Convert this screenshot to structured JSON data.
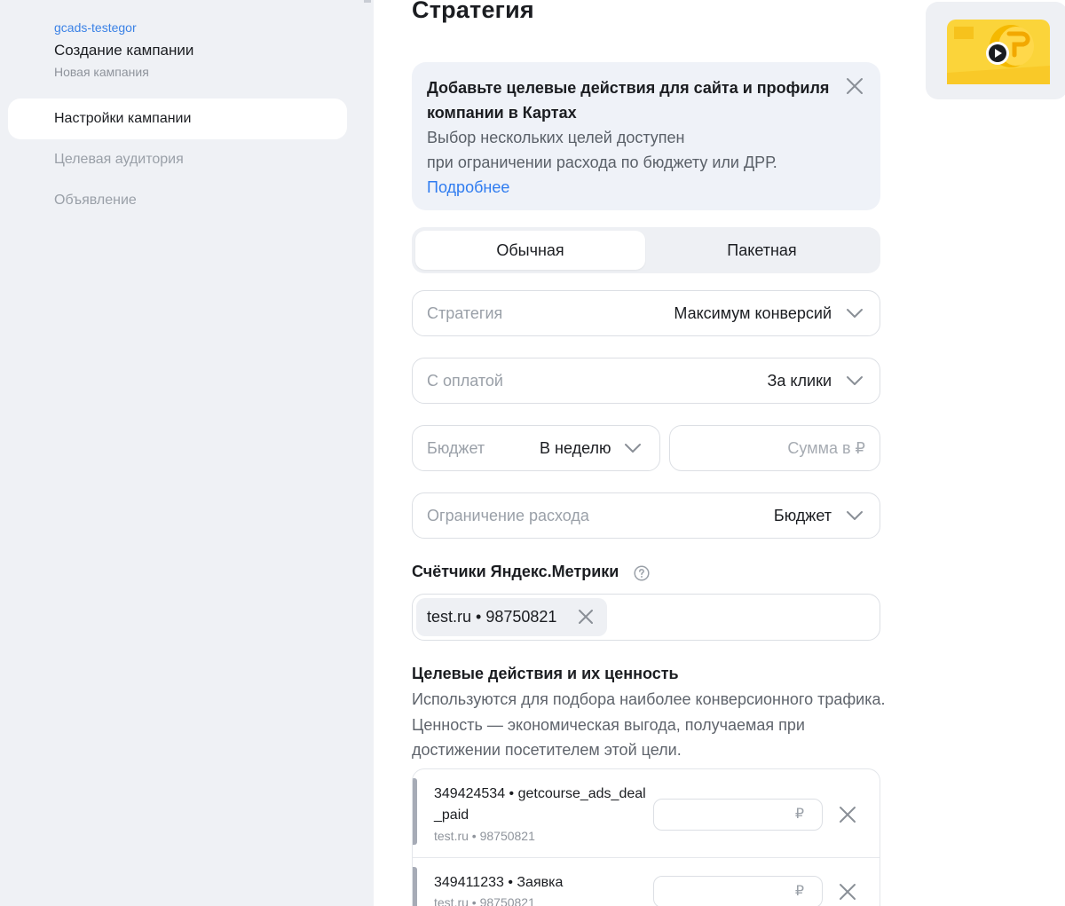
{
  "sidebar": {
    "account": "gcads-testegor",
    "title": "Создание кампании",
    "subtitle": "Новая кампания",
    "items": [
      {
        "label": "Настройки кампании"
      },
      {
        "label": "Целевая аудитория"
      },
      {
        "label": "Объявление"
      }
    ]
  },
  "main": {
    "title": "Стратегия",
    "banner": {
      "title": "Добавьте целевые действия для сайта и профиля компании в Картах",
      "line1": "Выбор нескольких целей доступен",
      "line2": "при ограничении расхода по бюджету или ДРР.",
      "link": "Подробнее"
    },
    "tabs": [
      {
        "label": "Обычная"
      },
      {
        "label": "Пакетная"
      }
    ],
    "fields": {
      "strategy": {
        "label": "Стратегия",
        "value": "Максимум конверсий"
      },
      "payment": {
        "label": "С оплатой",
        "value": "За клики"
      },
      "budget": {
        "label": "Бюджет",
        "value": "В неделю"
      },
      "amount": {
        "placeholder": "Сумма в ₽"
      },
      "limit": {
        "label": "Ограничение расхода",
        "value": "Бюджет"
      }
    },
    "counters": {
      "title": "Счётчики Яндекс.Метрики",
      "tag": "test.ru • 98750821"
    },
    "goals_section": {
      "title": "Целевые действия и их ценность",
      "description": "Используются для подбора наиболее конверсионного трафика. Ценность — экономическая выгода, получаемая при достижении посетителем этой цели.",
      "items": [
        {
          "name": "349424534 • getcourse_ads_deal_paid",
          "counter": "test.ru • 98750821",
          "currency": "₽"
        },
        {
          "name": "349411233 • Заявка",
          "counter": "test.ru • 98750821",
          "currency": "₽"
        }
      ]
    }
  }
}
